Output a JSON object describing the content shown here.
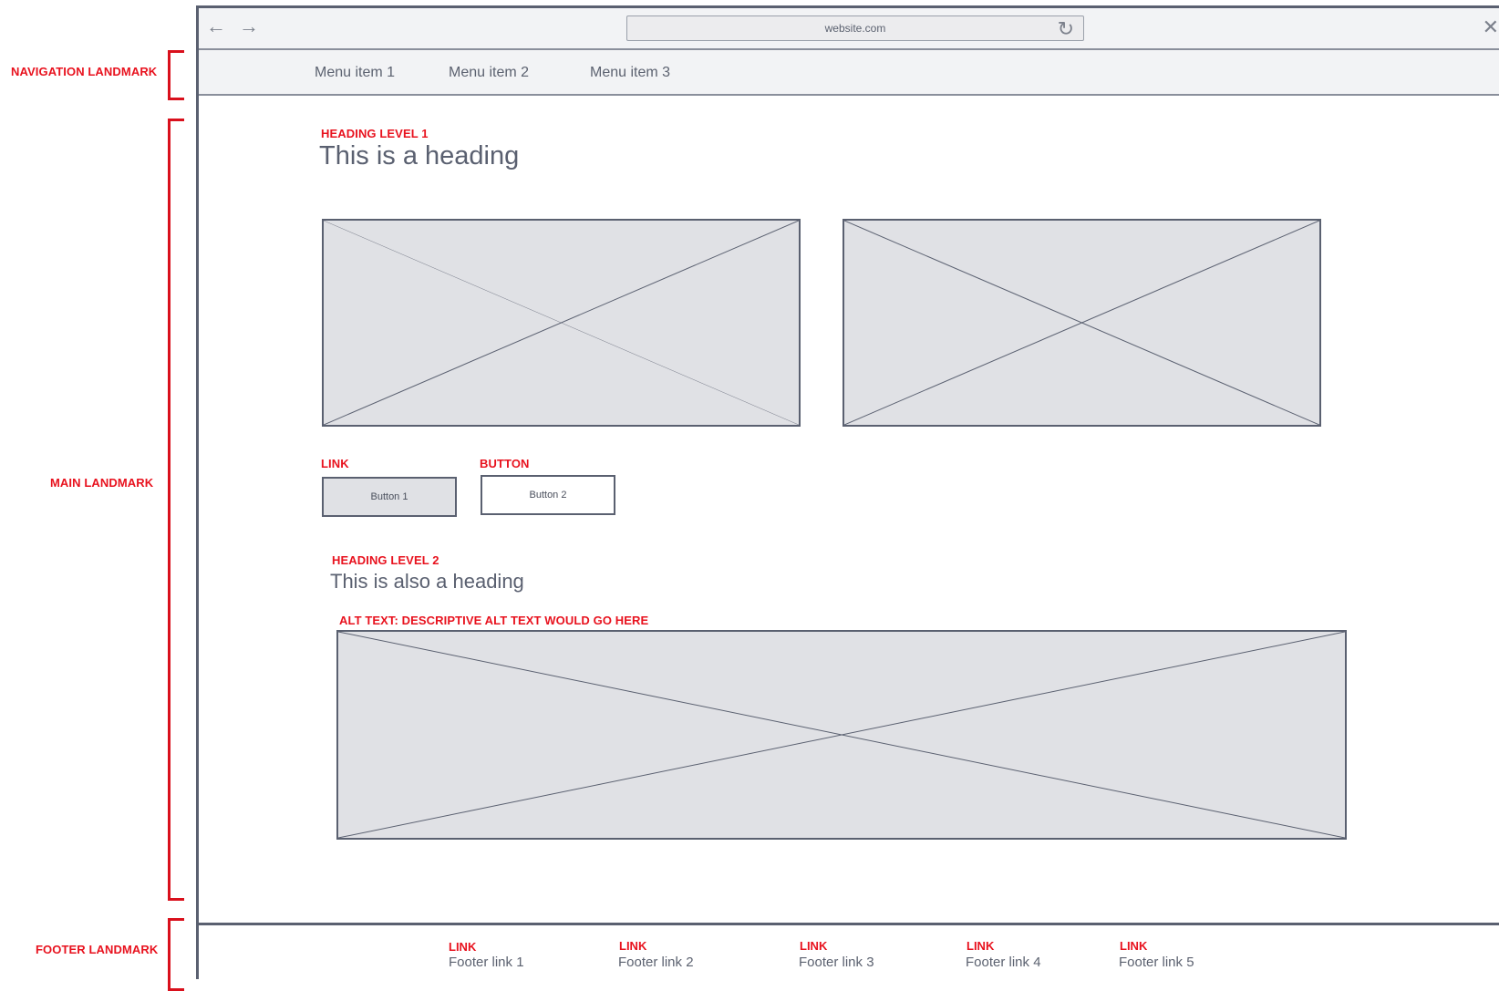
{
  "annotations": {
    "navigation": "NAVIGATION LANDMARK",
    "main": "MAIN LANDMARK",
    "footer": "FOOTER LANDMARK",
    "heading1": "HEADING LEVEL 1",
    "link": "LINK",
    "button": "BUTTON",
    "heading2": "HEADING LEVEL 2",
    "alt_text": "ALT TEXT: DESCRIPTIVE ALT TEXT WOULD GO HERE"
  },
  "browser": {
    "back_icon": "←",
    "forward_icon": "→",
    "url": "website.com",
    "reload_icon": "↻",
    "close_icon": "✕"
  },
  "nav": {
    "items": [
      "Menu item 1",
      "Menu item 2",
      "Menu item 3"
    ]
  },
  "main": {
    "heading1": "This is a heading",
    "buttons": [
      "Button 1",
      "Button 2"
    ],
    "heading2": "This is also a heading"
  },
  "footer": {
    "link_label": "LINK",
    "links": [
      "Footer link 1",
      "Footer link 2",
      "Footer link 3",
      "Footer link 4",
      "Footer link 5"
    ]
  },
  "colors": {
    "annotation": "#e8121e",
    "frame": "#5a6070",
    "placeholder_fill": "#e0e1e5"
  }
}
